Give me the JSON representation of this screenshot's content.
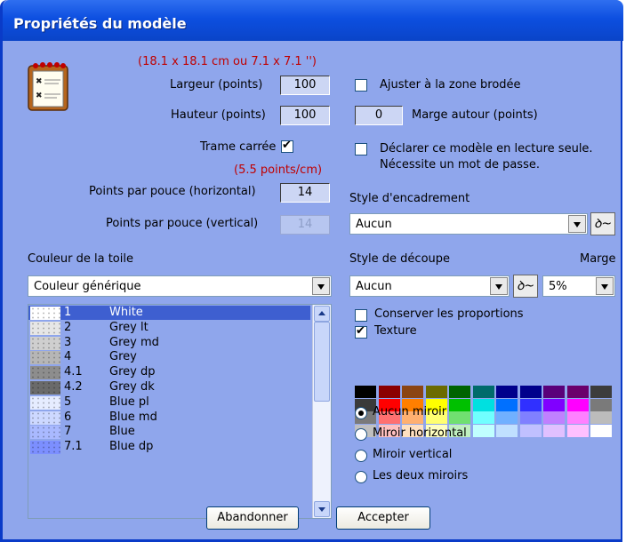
{
  "window": {
    "title": "Propriétés du modèle"
  },
  "size_note": "(18.1 x 18.1 cm ou 7.1 x 7.1 '')",
  "width": {
    "label": "Largeur (points)",
    "value": "100"
  },
  "height": {
    "label": "Hauteur (points)",
    "value": "100"
  },
  "square_grid": {
    "label": "Trame carrée",
    "checked": true
  },
  "density_note": "(5.5 points/cm)",
  "ppi_h": {
    "label": "Points par pouce (horizontal)",
    "value": "14"
  },
  "ppi_v": {
    "label": "Points par pouce (vertical)",
    "value": "14"
  },
  "fit_area": {
    "label": "Ajuster à la zone brodée",
    "checked": false
  },
  "margin_around": {
    "label": "Marge autour (points)",
    "value": "0"
  },
  "readonly": {
    "line1": "Déclarer ce modèle en lecture seule.",
    "line2": "Nécessite un mot de passe.",
    "checked": false
  },
  "frame_style": {
    "label": "Style d'encadrement",
    "value": "Aucun"
  },
  "cloth_color": {
    "label": "Couleur de la toile",
    "value": "Couleur générique"
  },
  "cut_style": {
    "label": "Style de découpe",
    "value": "Aucun"
  },
  "margin": {
    "label": "Marge",
    "value": "5%"
  },
  "keep_proportions": {
    "label": "Conserver les proportions",
    "checked": false
  },
  "texture": {
    "label": "Texture",
    "checked": true
  },
  "mirrors": [
    {
      "label": "Aucun miroir",
      "selected": true
    },
    {
      "label": "Miroir horizontal",
      "selected": false
    },
    {
      "label": "Miroir vertical",
      "selected": false
    },
    {
      "label": "Les deux miroirs",
      "selected": false
    }
  ],
  "colors": [
    {
      "code": "1",
      "name": "White",
      "swatch": "#ffffff",
      "selected": true
    },
    {
      "code": "2",
      "name": "Grey lt",
      "swatch": "#e6e6e6"
    },
    {
      "code": "3",
      "name": "Grey md",
      "swatch": "#cfcfcf"
    },
    {
      "code": "4",
      "name": "Grey",
      "swatch": "#b6b6b6"
    },
    {
      "code": "4.1",
      "name": "Grey dp",
      "swatch": "#8d8d8d"
    },
    {
      "code": "4.2",
      "name": "Grey dk",
      "swatch": "#6a6a6a"
    },
    {
      "code": "5",
      "name": "Blue pl",
      "swatch": "#e6ecff"
    },
    {
      "code": "6",
      "name": "Blue md",
      "swatch": "#cdd8ff"
    },
    {
      "code": "7",
      "name": "Blue",
      "swatch": "#a9b9ff"
    },
    {
      "code": "7.1",
      "name": "Blue dp",
      "swatch": "#7c8fff"
    }
  ],
  "palette_rows": [
    [
      "#000000",
      "#8b0000",
      "#8b4513",
      "#6b6b00",
      "#006400",
      "#006b6b",
      "#00008b",
      "#00008b",
      "#5a007a",
      "#6b006b",
      "#3c3c3c"
    ],
    [
      "#3a3a3a",
      "#ff0000",
      "#ff7f00",
      "#ffff00",
      "#00c000",
      "#00e0e0",
      "#0070ff",
      "#3030ff",
      "#8000ff",
      "#ff00ff",
      "#7a7a7a"
    ],
    [
      "#7a7a7a",
      "#ff7070",
      "#ffb070",
      "#ffff70",
      "#70e070",
      "#70ffff",
      "#70b0ff",
      "#8080ff",
      "#c080ff",
      "#ff80ff",
      "#bcbcbc"
    ],
    [
      "#c0c0c0",
      "#ffc0c0",
      "#ffe0c0",
      "#ffffc0",
      "#c0f0c0",
      "#c0ffff",
      "#c0e0ff",
      "#c0c0ff",
      "#e0c0ff",
      "#ffc0ff",
      "#ffffff"
    ]
  ],
  "buttons": {
    "cancel": "Abandonner",
    "accept": "Accepter"
  }
}
